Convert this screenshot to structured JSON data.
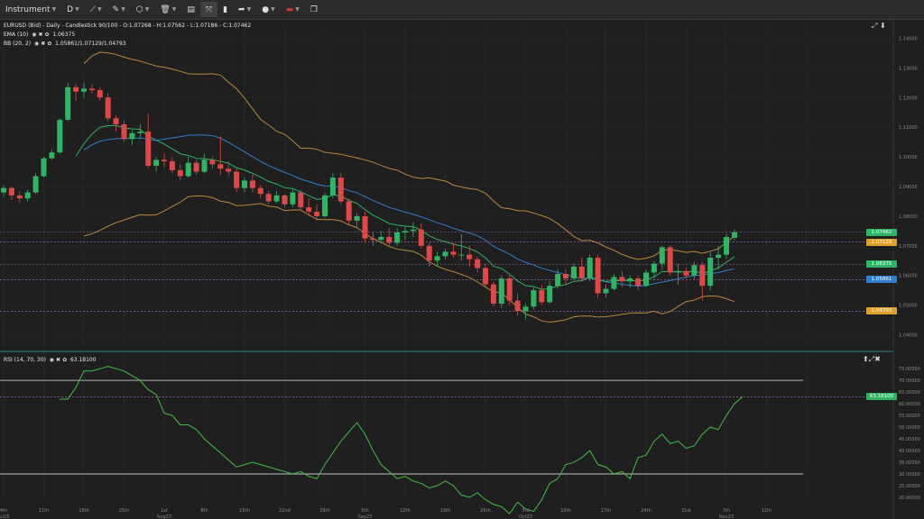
{
  "toolbar": {
    "instrument": "Instrument",
    "interval": "D",
    "icons": [
      "crosshair-icon",
      "draw-tool-icon",
      "shapes-icon",
      "trash-icon",
      "layout-icon",
      "fit-icon",
      "bar-chart-icon",
      "share-icon",
      "palette-icon",
      "flag-icon",
      "window-icon"
    ]
  },
  "main": {
    "header": "EURUSD (Bid) - Daily - Candlestick  90/100 - O:1.07268 - H:1.07562 - L:1.07186 - C:1.07462",
    "ema_label": "EMA (10)",
    "ema_value": "1.06375",
    "bb_label": "BB (20, 2)",
    "bb_value": "1.05861/1.07129/1.04793",
    "y_ticks": [
      "1.14000",
      "1.13000",
      "1.12000",
      "1.11000",
      "1.10000",
      "1.09000",
      "1.08000",
      "1.07000",
      "1.06000",
      "1.05000",
      "1.04000"
    ],
    "badges": [
      {
        "text": "1.07462",
        "color": "#2db564",
        "y": 1.07462
      },
      {
        "text": "1.07129",
        "color": "#e0a030",
        "y": 1.07129
      },
      {
        "text": "1.06375",
        "color": "#2db564",
        "y": 1.06375
      },
      {
        "text": "1.05861",
        "color": "#2f7fd0",
        "y": 1.05861
      },
      {
        "text": "1.04793",
        "color": "#e0a030",
        "y": 1.04793
      }
    ]
  },
  "rsi": {
    "label": "RSI (14, 70, 30)",
    "value": "63.18100",
    "badge": "63.18100",
    "y_ticks": [
      "75.00000",
      "70.00000",
      "65.00000",
      "60.00000",
      "55.00000",
      "50.00000",
      "45.00000",
      "40.00000",
      "35.00000",
      "30.00000",
      "25.00000",
      "20.00000"
    ]
  },
  "x_axis": {
    "ticks": [
      {
        "label": "4th",
        "sub": "Jul23",
        "i": 0
      },
      {
        "label": "11th",
        "sub": "",
        "i": 5
      },
      {
        "label": "18th",
        "sub": "",
        "i": 10
      },
      {
        "label": "25th",
        "sub": "",
        "i": 15
      },
      {
        "label": "1st",
        "sub": "Aug23",
        "i": 20
      },
      {
        "label": "8th",
        "sub": "",
        "i": 25
      },
      {
        "label": "15th",
        "sub": "",
        "i": 30
      },
      {
        "label": "22nd",
        "sub": "",
        "i": 35
      },
      {
        "label": "29th",
        "sub": "",
        "i": 40
      },
      {
        "label": "5th",
        "sub": "Sep23",
        "i": 45
      },
      {
        "label": "12th",
        "sub": "",
        "i": 50
      },
      {
        "label": "19th",
        "sub": "",
        "i": 55
      },
      {
        "label": "26th",
        "sub": "",
        "i": 60
      },
      {
        "label": "3rd",
        "sub": "Oct23",
        "i": 65
      },
      {
        "label": "10th",
        "sub": "",
        "i": 70
      },
      {
        "label": "17th",
        "sub": "",
        "i": 75
      },
      {
        "label": "24th",
        "sub": "",
        "i": 80
      },
      {
        "label": "31st",
        "sub": "",
        "i": 85
      },
      {
        "label": "7th",
        "sub": "Nov23",
        "i": 90
      },
      {
        "label": "12th",
        "sub": "",
        "i": 95
      }
    ]
  },
  "chart_data": {
    "type": "candlestick",
    "ylim": [
      1.035,
      1.145
    ],
    "candles": [
      [
        1.088,
        1.0905,
        1.0865,
        1.0895
      ],
      [
        1.0895,
        1.09,
        1.0855,
        1.087
      ],
      [
        1.087,
        1.0885,
        1.0845,
        1.086
      ],
      [
        1.086,
        1.089,
        1.085,
        1.088
      ],
      [
        1.088,
        1.0945,
        1.0875,
        1.0935
      ],
      [
        1.0935,
        1.1,
        1.093,
        1.0995
      ],
      [
        1.0995,
        1.1025,
        1.099,
        1.1015
      ],
      [
        1.1015,
        1.113,
        1.101,
        1.1125
      ],
      [
        1.1125,
        1.125,
        1.112,
        1.1235
      ],
      [
        1.1235,
        1.1245,
        1.119,
        1.122
      ],
      [
        1.122,
        1.125,
        1.12,
        1.123
      ],
      [
        1.123,
        1.1245,
        1.1215,
        1.1225
      ],
      [
        1.1225,
        1.1235,
        1.119,
        1.12
      ],
      [
        1.12,
        1.1215,
        1.112,
        1.113
      ],
      [
        1.113,
        1.114,
        1.1085,
        1.111
      ],
      [
        1.111,
        1.1125,
        1.105,
        1.106
      ],
      [
        1.106,
        1.109,
        1.104,
        1.108
      ],
      [
        1.108,
        1.111,
        1.106,
        1.1085
      ],
      [
        1.1085,
        1.1145,
        1.096,
        1.097
      ],
      [
        1.097,
        1.1,
        1.095,
        1.099
      ],
      [
        1.099,
        1.101,
        1.0965,
        1.0985
      ],
      [
        1.0985,
        1.1,
        1.0945,
        1.0955
      ],
      [
        1.0955,
        1.0975,
        1.092,
        1.0935
      ],
      [
        1.0935,
        1.1,
        1.093,
        1.098
      ],
      [
        1.098,
        1.099,
        1.094,
        1.095
      ],
      [
        1.095,
        1.101,
        1.0945,
        1.099
      ],
      [
        1.099,
        1.1,
        1.096,
        1.0975
      ],
      [
        1.0975,
        1.107,
        1.094,
        1.096
      ],
      [
        1.096,
        1.0985,
        1.0935,
        1.095
      ],
      [
        1.095,
        1.096,
        1.088,
        1.0895
      ],
      [
        1.0895,
        1.093,
        1.088,
        1.092
      ],
      [
        1.092,
        1.094,
        1.088,
        1.0895
      ],
      [
        1.0895,
        1.0905,
        1.086,
        1.0875
      ],
      [
        1.0875,
        1.0885,
        1.084,
        1.085
      ],
      [
        1.085,
        1.0885,
        1.0845,
        1.087
      ],
      [
        1.087,
        1.0875,
        1.083,
        1.084
      ],
      [
        1.084,
        1.089,
        1.083,
        1.088
      ],
      [
        1.088,
        1.089,
        1.082,
        1.083
      ],
      [
        1.083,
        1.086,
        1.08,
        1.0815
      ],
      [
        1.0815,
        1.084,
        1.0785,
        1.08
      ],
      [
        1.08,
        1.088,
        1.0795,
        1.087
      ],
      [
        1.087,
        1.0945,
        1.086,
        1.093
      ],
      [
        1.093,
        1.0945,
        1.084,
        1.085
      ],
      [
        1.085,
        1.086,
        1.077,
        1.0785
      ],
      [
        1.0785,
        1.081,
        1.0765,
        1.08
      ],
      [
        1.08,
        1.0815,
        1.071,
        1.0725
      ],
      [
        1.0725,
        1.0745,
        1.07,
        1.072
      ],
      [
        1.072,
        1.075,
        1.071,
        1.073
      ],
      [
        1.073,
        1.076,
        1.07,
        1.071
      ],
      [
        1.071,
        1.076,
        1.07,
        1.0745
      ],
      [
        1.0745,
        1.0765,
        1.072,
        1.075
      ],
      [
        1.075,
        1.078,
        1.073,
        1.0755
      ],
      [
        1.0755,
        1.0775,
        1.069,
        1.07
      ],
      [
        1.07,
        1.071,
        1.063,
        1.065
      ],
      [
        1.065,
        1.068,
        1.063,
        1.0665
      ],
      [
        1.0665,
        1.069,
        1.0655,
        1.068
      ],
      [
        1.068,
        1.071,
        1.066,
        1.067
      ],
      [
        1.067,
        1.074,
        1.065,
        1.067
      ],
      [
        1.067,
        1.07,
        1.063,
        1.0655
      ],
      [
        1.0655,
        1.0665,
        1.061,
        1.0625
      ],
      [
        1.0625,
        1.064,
        1.056,
        1.057
      ],
      [
        1.057,
        1.058,
        1.0495,
        1.0505
      ],
      [
        1.0505,
        1.06,
        1.049,
        1.059
      ],
      [
        1.059,
        1.06,
        1.05,
        1.0515
      ],
      [
        1.0515,
        1.054,
        1.0465,
        1.048
      ],
      [
        1.048,
        1.0505,
        1.045,
        1.0495
      ],
      [
        1.0495,
        1.056,
        1.0485,
        1.055
      ],
      [
        1.055,
        1.057,
        1.05,
        1.051
      ],
      [
        1.051,
        1.058,
        1.0505,
        1.0565
      ],
      [
        1.0565,
        1.062,
        1.0555,
        1.0605
      ],
      [
        1.0605,
        1.062,
        1.057,
        1.059
      ],
      [
        1.059,
        1.064,
        1.0585,
        1.063
      ],
      [
        1.063,
        1.066,
        1.058,
        1.059
      ],
      [
        1.059,
        1.067,
        1.058,
        1.066
      ],
      [
        1.066,
        1.067,
        1.0525,
        1.054
      ],
      [
        1.054,
        1.057,
        1.0525,
        1.0555
      ],
      [
        1.0555,
        1.0605,
        1.055,
        1.0595
      ],
      [
        1.0595,
        1.0615,
        1.056,
        1.058
      ],
      [
        1.058,
        1.06,
        1.056,
        1.059
      ],
      [
        1.059,
        1.06,
        1.055,
        1.0565
      ],
      [
        1.0565,
        1.062,
        1.056,
        1.061
      ],
      [
        1.061,
        1.065,
        1.059,
        1.064
      ],
      [
        1.064,
        1.07,
        1.062,
        1.0695
      ],
      [
        1.0695,
        1.07,
        1.06,
        1.061
      ],
      [
        1.061,
        1.064,
        1.057,
        1.0615
      ],
      [
        1.0615,
        1.0625,
        1.059,
        1.06
      ],
      [
        1.06,
        1.0645,
        1.0585,
        1.0635
      ],
      [
        1.0635,
        1.0645,
        1.0515,
        1.0565
      ],
      [
        1.0565,
        1.068,
        1.055,
        1.066
      ],
      [
        1.066,
        1.07,
        1.062,
        1.067
      ],
      [
        1.067,
        1.074,
        1.0655,
        1.073
      ],
      [
        1.0727,
        1.0756,
        1.0719,
        1.0746
      ]
    ],
    "ema10_index_range": [
      9,
      91
    ],
    "bb_mid_index_range": [
      9,
      91
    ],
    "rsi_values": [
      null,
      null,
      null,
      null,
      null,
      null,
      null,
      62,
      62,
      67,
      74,
      74,
      75,
      76,
      75,
      74,
      72,
      70,
      66,
      64,
      56,
      55,
      51,
      51,
      49,
      45,
      42,
      39,
      36,
      33,
      34,
      35,
      34,
      33,
      32,
      31,
      30,
      31,
      29,
      28,
      34,
      39,
      44,
      48,
      52,
      47,
      40,
      34,
      31,
      28,
      29,
      27,
      26,
      24,
      25,
      27,
      25,
      21,
      20,
      22,
      19,
      17,
      16,
      13,
      18,
      15,
      14,
      19,
      26,
      28,
      34,
      35,
      37,
      40,
      34,
      33,
      30,
      31,
      28,
      37,
      38,
      44,
      47,
      43,
      44,
      41,
      42,
      47,
      50,
      49,
      55,
      60,
      63
    ],
    "rsi_ylim": [
      20,
      77
    ],
    "rsi_levels": [
      70,
      30
    ]
  }
}
